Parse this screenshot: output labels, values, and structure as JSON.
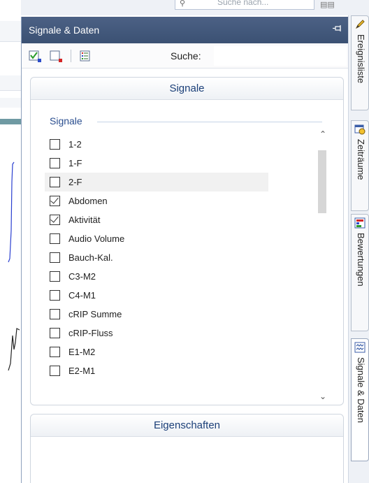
{
  "background": {
    "search_placeholder": "Suche nach..."
  },
  "panel": {
    "title": "Signale & Daten",
    "search_label": "Suche:",
    "search_value": ""
  },
  "signals_group": {
    "header": "Signale",
    "legend": "Signale",
    "items": [
      {
        "label": "1-2",
        "checked": false
      },
      {
        "label": "1-F",
        "checked": false
      },
      {
        "label": "2-F",
        "checked": false,
        "hover": true
      },
      {
        "label": "Abdomen",
        "checked": true
      },
      {
        "label": "Aktivität",
        "checked": true
      },
      {
        "label": "Audio Volume",
        "checked": false
      },
      {
        "label": "Bauch-Kal.",
        "checked": false
      },
      {
        "label": "C3-M2",
        "checked": false
      },
      {
        "label": "C4-M1",
        "checked": false
      },
      {
        "label": "cRIP Summe",
        "checked": false
      },
      {
        "label": "cRIP-Fluss",
        "checked": false
      },
      {
        "label": "E1-M2",
        "checked": false
      },
      {
        "label": "E2-M1",
        "checked": false
      }
    ]
  },
  "properties_group": {
    "header": "Eigenschaften"
  },
  "right_tabs": [
    {
      "label": "Ereignisliste",
      "icon": "pencil-icon"
    },
    {
      "label": "Zeiträume",
      "icon": "clock-icon"
    },
    {
      "label": "Bewertungen",
      "icon": "chart-icon"
    },
    {
      "label": "Signale & Daten",
      "icon": "wave-icon",
      "active": true
    }
  ],
  "colors": {
    "title_bar": "#3f5679",
    "group_header_text": "#1b3f78",
    "legend_text": "#2a4e8f"
  }
}
